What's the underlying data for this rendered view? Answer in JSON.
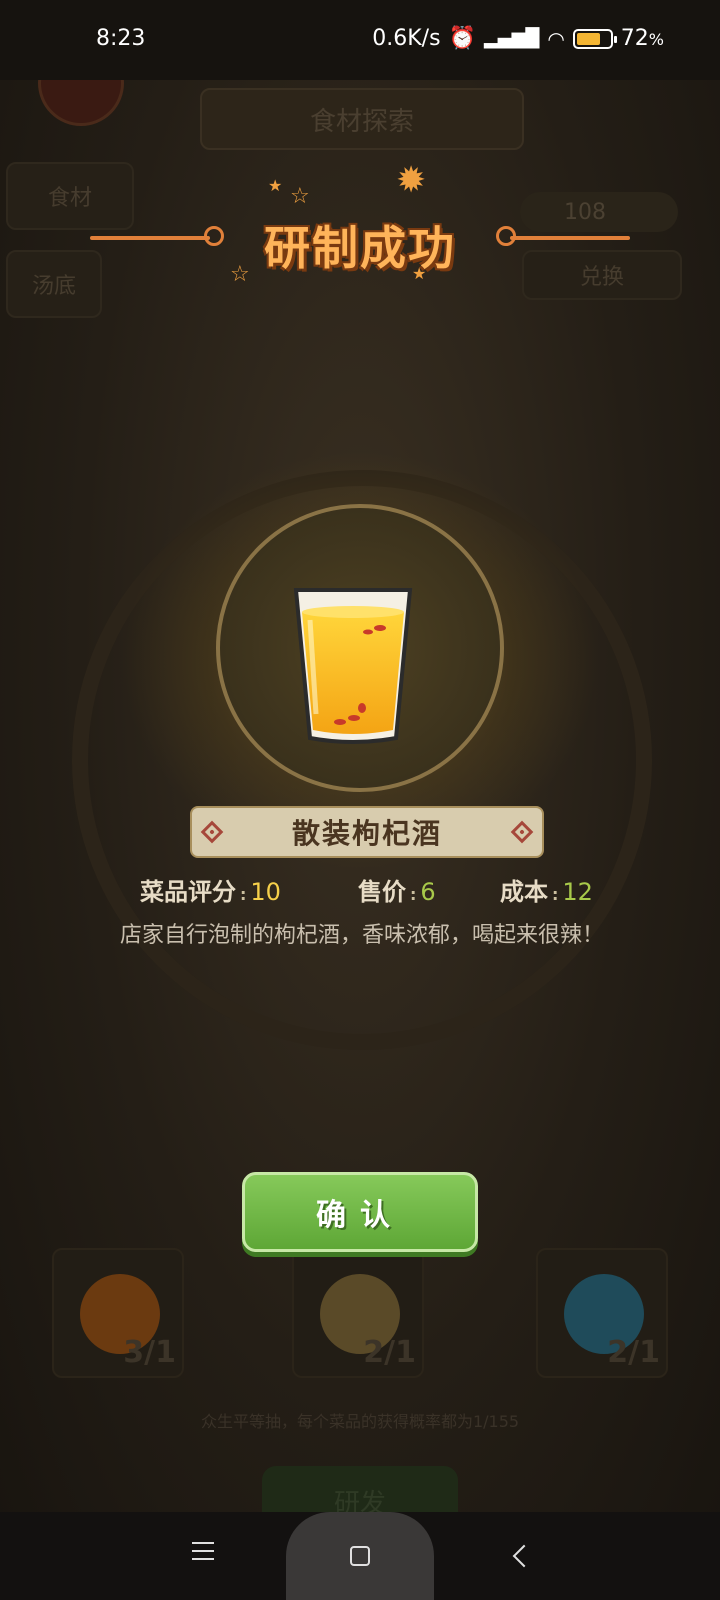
{
  "status_bar": {
    "time": "8:23",
    "net_speed": "0.6K/s",
    "battery": "72",
    "battery_percent_sign": "%",
    "icons": [
      "alarm-icon",
      "hd-signal-icon",
      "wifi-icon",
      "battery-icon"
    ],
    "battery_level": 0.72
  },
  "background_scene": {
    "panel_title": "食材探索",
    "tab_ingredients": "食材",
    "tab_broth": "汤底",
    "clover_count": "108",
    "exchange_label": "兑换",
    "slots": [
      {
        "count": "3/1",
        "color": "#6b3a10"
      },
      {
        "count": "2/1",
        "color": "#5a4a28"
      },
      {
        "count": "2/1",
        "color": "#1f4b5a"
      }
    ],
    "hint": "众生平等抽，每个菜品的获得概率都为1/155",
    "develop_label": "研发"
  },
  "dialog": {
    "title": "研制成功",
    "dish_name": "散装枸杞酒",
    "rating_label": "菜品评分",
    "rating_value": "10",
    "price_label": "售价",
    "price_value": "6",
    "cost_label": "成本",
    "cost_value": "12",
    "separator": ":",
    "description": "店家自行泡制的枸杞酒，香味浓郁，喝起来很辣！",
    "confirm_label": "确认"
  },
  "colors": {
    "title": "#ffb45a",
    "rating_value": "#f6d04a",
    "price_cost_value": "#a8c94a",
    "confirm_green": "#6db544"
  }
}
